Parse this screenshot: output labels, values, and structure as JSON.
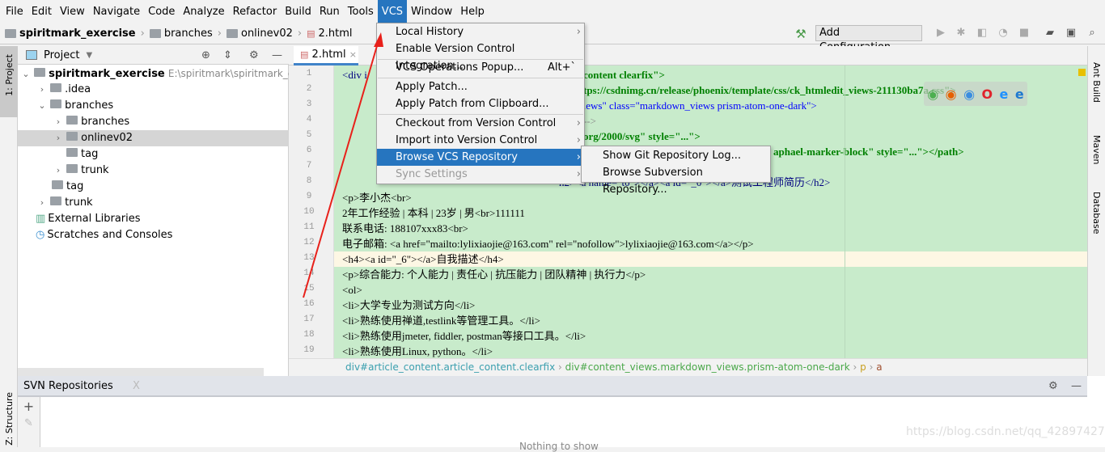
{
  "menubar": [
    "File",
    "Edit",
    "View",
    "Navigate",
    "Code",
    "Analyze",
    "Refactor",
    "Build",
    "Run",
    "Tools",
    "VCS",
    "Window",
    "Help"
  ],
  "toolbar": {
    "crumbs": [
      "spiritmark_exercise",
      "branches",
      "onlinev02",
      "2.html"
    ],
    "add_configuration": "Add Configuration..."
  },
  "left_strip": {
    "project_tab": "1: Project",
    "structure_tab": "Z: Structure"
  },
  "project": {
    "title": "Project",
    "root": "spiritmark_exercise",
    "root_path": "E:\\spiritmark\\spiritmark_exe",
    "items": [
      ".idea",
      "branches",
      "branches",
      "onlinev02",
      "tag",
      "trunk",
      "tag",
      "trunk",
      "External Libraries",
      "Scratches and Consoles"
    ]
  },
  "editor": {
    "tab": "2.html",
    "line_numbers": [
      "1",
      "2",
      "3",
      "4",
      "5",
      "6",
      "7",
      "8",
      "9",
      "10",
      "11",
      "12",
      "13",
      "14",
      "15",
      "16",
      "17",
      "18",
      "19"
    ],
    "lines": {
      "l1a": "<div i",
      "l1b": "content clearfix\">",
      "l2b": "tps://csdnimg.cn/release/phoenix/template/css/ck_htmledit_views-211130ba7a.css\">",
      "l3b": ".ews\" class=\"markdown_views prism-atom-one-dark\">",
      "l4b": "-->",
      "l5b": "org/2000/svg\" style=\"...\">",
      "l6b": "aphael-marker-block\" style=\"...\"></path>",
      "l8b": "h2><a name=\"t0\"></a><a id=\"_0\"></a>测试工程师简历</h2>",
      "l9": "<p>李小杰<br>",
      "l10": "2年工作经验 | 本科 | 23岁 | 男<br>111111",
      "l11": "联系电话: 188107xxx83<br>",
      "l12": "电子邮箱: <a href=\"mailto:lylixiaojie@163.com\" rel=\"nofollow\">lylixiaojie@163.com</a></p>",
      "l13": "<h4><a id=\"_6\"></a>自我描述</h4>",
      "l14": "<p>综合能力: 个人能力 | 责任心 | 抗压能力 | 团队精神 | 执行力</p>",
      "l15": "<ol>",
      "l16": "<li>大学专业为测试方向</li>",
      "l17": "<li>熟练使用禅道,testlink等管理工具。</li>",
      "l18": "<li>熟练使用jmeter, fiddler, postman等接口工具。</li>",
      "l19": "<li>熟练使用Linux, python。</li>"
    },
    "breadcrumb": [
      "div#article_content.article_content.clearfix",
      "div#content_views.markdown_views.prism-atom-one-dark",
      "p",
      "a"
    ],
    "browser_icons": [
      "chrome",
      "firefox",
      "safari",
      "opera",
      "ie",
      "edge"
    ]
  },
  "right_strip": [
    "Ant Build",
    "Maven",
    "Database"
  ],
  "svn": {
    "title": "SVN Repositories",
    "close": "X",
    "empty": "Nothing to show"
  },
  "vcs_menu": {
    "items": [
      {
        "label": "Local History",
        "submenu": true
      },
      {
        "label": "Enable Version Control Integration..."
      },
      {
        "label": "VCS Operations Popup...",
        "shortcut": "Alt+`"
      },
      {
        "label": "Apply Patch..."
      },
      {
        "label": "Apply Patch from Clipboard..."
      },
      {
        "label": "Checkout from Version Control",
        "submenu": true
      },
      {
        "label": "Import into Version Control",
        "submenu": true
      },
      {
        "label": "Browse VCS Repository",
        "submenu": true,
        "highlighted": true
      },
      {
        "label": "Sync Settings",
        "submenu": true,
        "disabled": true
      }
    ],
    "submenu": [
      "Show Git Repository Log...",
      "Browse Subversion Repository..."
    ]
  },
  "watermark": "https://blog.csdn.net/qq_42897427",
  "colors": {
    "accent": "#2675bf",
    "code_bg": "#c8ebcb",
    "annotation_arrow": "#e8201a"
  }
}
